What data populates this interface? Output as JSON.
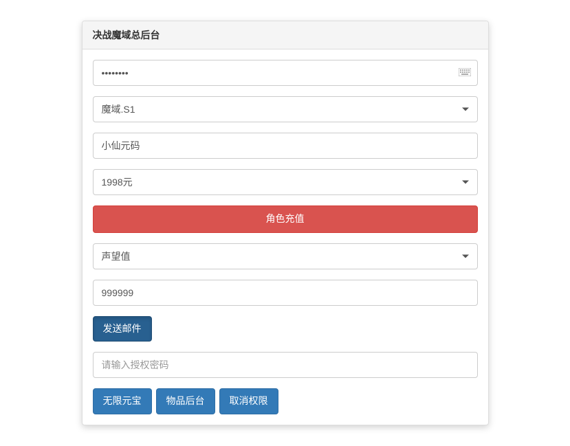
{
  "panel": {
    "title": "决战魔域总后台"
  },
  "form": {
    "password_value": "••••••••",
    "server_selected": "魔域.S1",
    "character_name": "小仙元码",
    "amount_selected": "1998元",
    "recharge_button": "角色充值",
    "attr_selected": "声望值",
    "attr_value": "999999",
    "send_mail_button": "发送邮件",
    "auth_placeholder": "请输入授权密码",
    "unlimited_yuanbao": "无限元宝",
    "item_backend": "物品后台",
    "cancel_auth": "取消权限"
  }
}
